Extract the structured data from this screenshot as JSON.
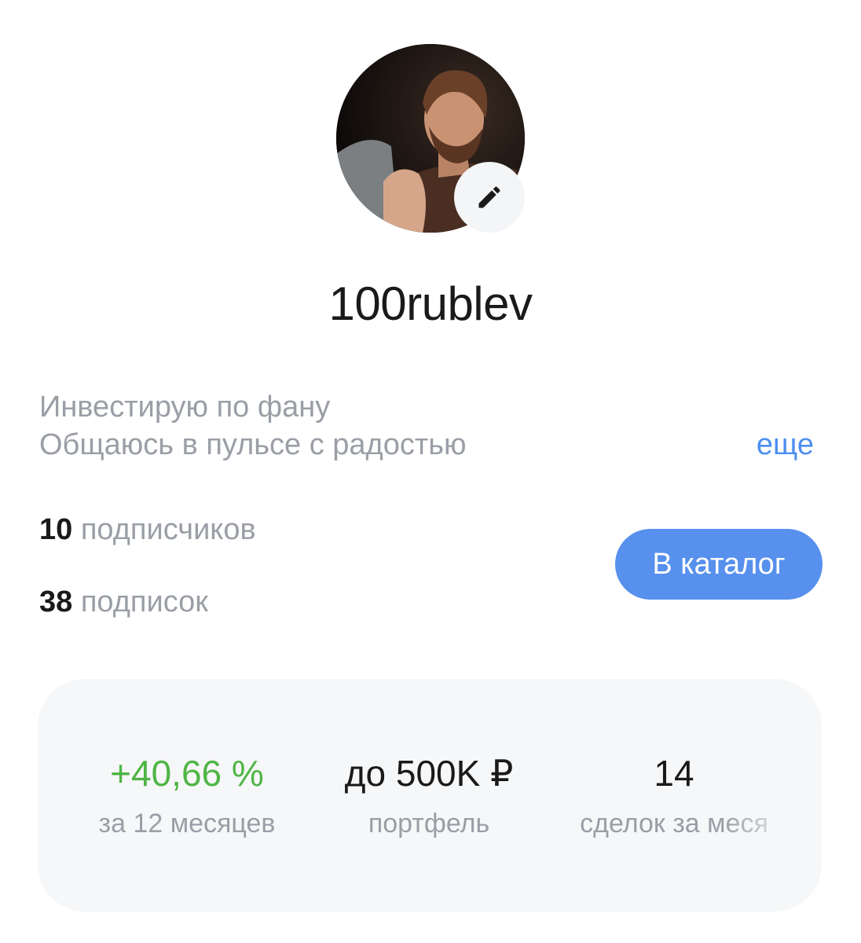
{
  "profile": {
    "username": "100rublev",
    "avatar_icon": "user-photo",
    "edit_icon": "pencil-icon",
    "bio_lines": [
      "Инвестирую по фану",
      "Общаюсь в пульсе с радостью"
    ],
    "more_label": "еще"
  },
  "stats": {
    "followers_count": "10",
    "followers_label": "подписчиков",
    "following_count": "38",
    "following_label": "подписок"
  },
  "catalog_button": {
    "label": "В каталог"
  },
  "metrics": [
    {
      "value": "+40,66 %",
      "label": "за 12 месяцев"
    },
    {
      "value": "до 500K ₽",
      "label": "портфель"
    },
    {
      "value": "14",
      "label": "сделок за меся"
    }
  ],
  "colors": {
    "accent": "#5790ed",
    "link": "#4c8ef0",
    "positive": "#4fb546",
    "muted_text": "#9a9ea6",
    "card_bg": "#f6f7f8"
  }
}
